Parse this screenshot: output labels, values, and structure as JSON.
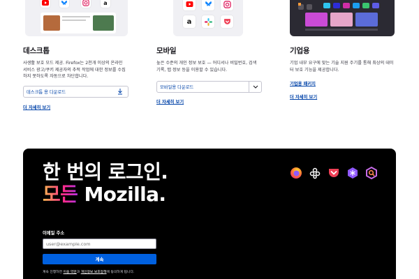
{
  "columns": [
    {
      "title": "데스크톱",
      "desc": "사생활 보호 모드 제공. Firefox는 2천개 이상의 온라인 서비스 광고/쿠키 제공자의 추적 작업에 대한 정보를 수집하지 못하도록 자동으로 차단합니다.",
      "download_label": "데스크톱 용 다운로드",
      "more_label": "더 자세히 보기"
    },
    {
      "title": "모바일",
      "desc": "높은 수준의 개인 정보 보호 — 어디서나 비밀번호, 검색 기록, 탭 정보 등을 이용할 수 있습니다.",
      "download_label": "모바일용 다운로드",
      "more_label": "더 자세히 보기"
    },
    {
      "title": "기업용",
      "desc": "기업 내부 요구에 맞는 기술 지원 주기를 통해 최상의 데이터 보호 기능을 제공합니다.",
      "package_label": "기업용 패키지",
      "more_label": "더 자세히 보기"
    }
  ],
  "promo": {
    "line1": "한 번의 로그인.",
    "line2_grad": "모든",
    "line2_rest": " Mozilla.",
    "email_label": "이메일 주소",
    "email_placeholder": "user@example.com",
    "continue_label": "계속",
    "terms_pre": "계속 진행하면 ",
    "terms_link1": "이용 약관",
    "terms_mid": "과 ",
    "terms_link2": "개인정보 보호정책",
    "terms_post": "에 동의하게 됩니다.",
    "logos": [
      "firefox-icon",
      "mozilla-vpn-icon",
      "pocket-icon",
      "relay-icon",
      "monitor-icon"
    ]
  },
  "colors": {
    "link": "#0042a8",
    "continue_button": "#0060df",
    "promo_bg": "#000000"
  }
}
